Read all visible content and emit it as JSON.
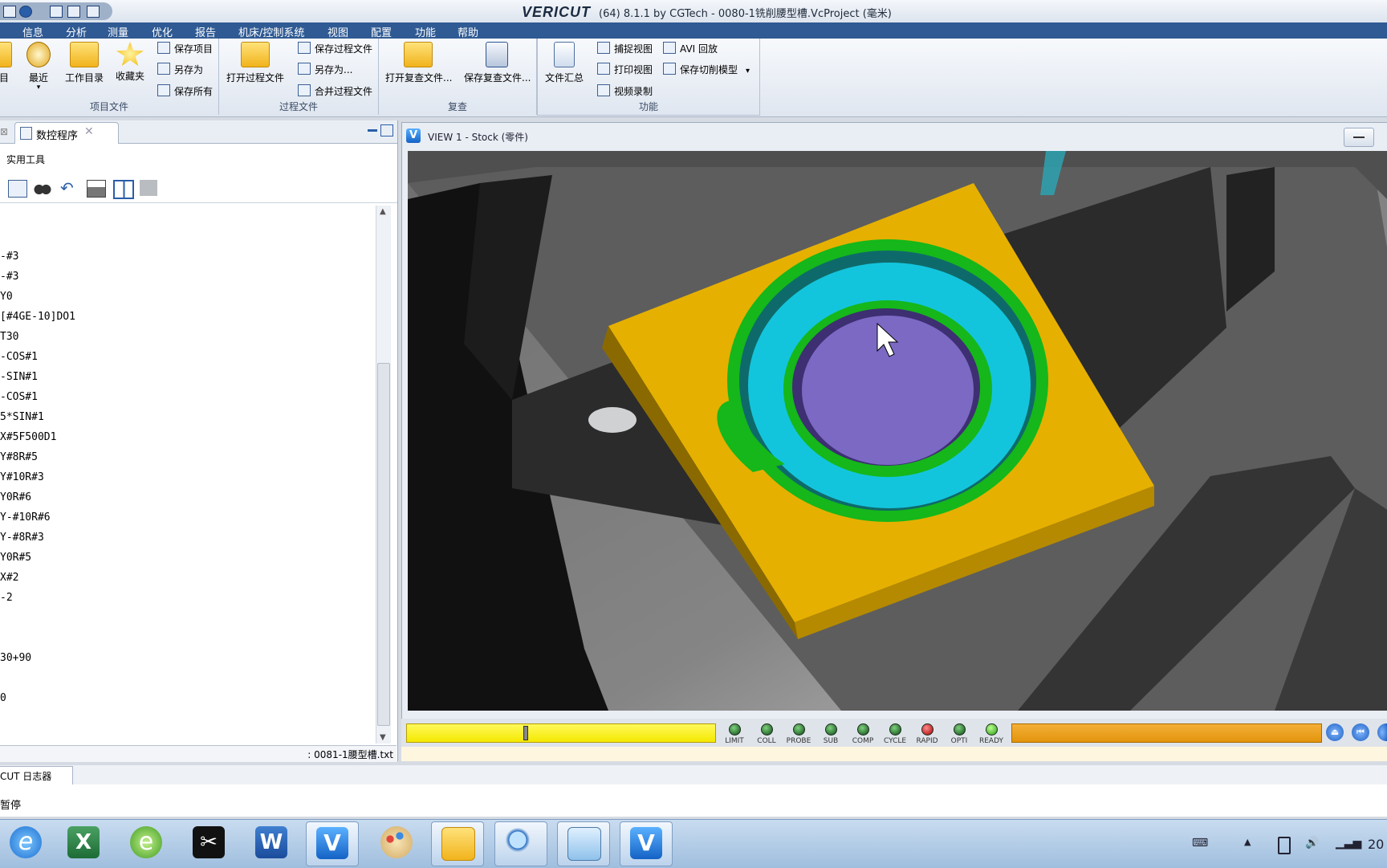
{
  "titlebar": {
    "app_name": "VERICUT",
    "title": "(64)  8.1.1 by CGTech - 0080-1铣削腰型槽.VcProject (毫米)"
  },
  "menu": [
    "信息",
    "分析",
    "测量",
    "优化",
    "报告",
    "机床/控制系统",
    "视图",
    "配置",
    "功能",
    "帮助"
  ],
  "ribbon": {
    "project_group": {
      "label": "项目文件",
      "project": "项目",
      "recent": "最近",
      "work_dir": "工作目录",
      "favorites": "收藏夹",
      "save_project": "保存项目",
      "save_as": "另存为",
      "save_all": "保存所有"
    },
    "process_group": {
      "label": "过程文件",
      "open_process": "打开过程文件",
      "save_process": "保存过程文件",
      "save_as_dots": "另存为...",
      "merge_process": "合并过程文件"
    },
    "review_group": {
      "label": "复查",
      "open_review": "打开复查文件...",
      "save_review": "保存复查文件..."
    },
    "function_group": {
      "label": "功能",
      "file_summary": "文件汇总",
      "capture_view": "捕捉视图",
      "print_view": "打印视图",
      "video_record": "视频录制",
      "avi_playback": "AVI 回放",
      "save_cut_model": "保存切削模型"
    }
  },
  "left_panel": {
    "tab_label": "数控程序",
    "tools_label": "实用工具",
    "code_lines": [
      "-#3",
      "-#3",
      "Y0",
      "[#4GE-10]DO1",
      "T30",
      "-COS#1",
      "-SIN#1",
      "-COS#1",
      "5*SIN#1",
      "X#5F500D1",
      "Y#8R#5",
      "Y#10R#3",
      "Y0R#6",
      "Y-#10R#6",
      "Y-#8R#3",
      "Y0R#5",
      "X#2",
      "-2",
      "",
      "",
      "30+90",
      "",
      "0"
    ],
    "status_file": ": 0081-1腰型槽.txt"
  },
  "view": {
    "title": "VIEW 1 - Stock (零件)",
    "colors": {
      "stock": "#e6b000",
      "green_wall": "#15b71a",
      "cyan_floor": "#13c5dc",
      "purple_island": "#7c69c4"
    }
  },
  "status_leds": [
    {
      "label": "LIMIT",
      "state": "dark-green"
    },
    {
      "label": "COLL",
      "state": "dark-green"
    },
    {
      "label": "PROBE",
      "state": "dark-green"
    },
    {
      "label": "SUB",
      "state": "dark-green"
    },
    {
      "label": "COMP",
      "state": "dark-green"
    },
    {
      "label": "CYCLE",
      "state": "dark-green"
    },
    {
      "label": "RAPID",
      "state": "red"
    },
    {
      "label": "OPTI",
      "state": "dark-green"
    },
    {
      "label": "READY",
      "state": "green"
    }
  ],
  "log": {
    "tab_label": "CUT 日志器",
    "line1": "暂停"
  },
  "taskbar": {
    "apps": [
      "internet-explorer",
      "excel",
      "browser",
      "capcut",
      "word",
      "vericut",
      "paint",
      "file-explorer",
      "magnifier",
      "notepad",
      "vericut"
    ],
    "clock_partial": "20"
  }
}
